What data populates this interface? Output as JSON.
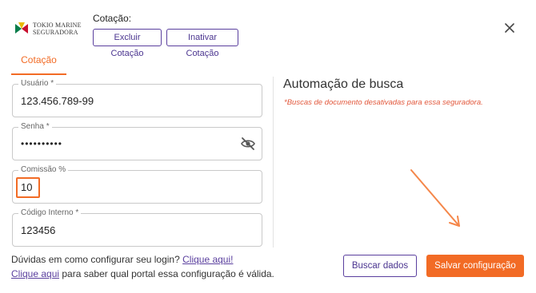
{
  "header": {
    "logo_line1": "TOKIO MARINE",
    "logo_line2": "SEGURADORA",
    "cotacao_label": "Cotação:",
    "excluir_label": "Excluir Cotação",
    "inativar_label": "Inativar Cotação",
    "close_icon": "close-icon"
  },
  "tabs": [
    {
      "label": "Cotação",
      "active": true
    }
  ],
  "form": {
    "usuario": {
      "label": "Usuário *",
      "value": "123.456.789-99"
    },
    "senha": {
      "label": "Senha *",
      "value": "••••••••••",
      "icon": "eye-off-icon"
    },
    "comissao": {
      "label": "Comissão %",
      "value": "10"
    },
    "codigo": {
      "label": "Código Interno *",
      "value": "123456"
    }
  },
  "automation": {
    "title": "Automação de busca",
    "note": "*Buscas de documento desativadas para essa seguradora."
  },
  "help": {
    "line1_text": "Dúvidas em como configurar seu login? ",
    "line1_link": "Clique aqui!",
    "line2_link": "Clique aqui",
    "line2_text": " para saber qual portal essa configuração é válida."
  },
  "actions": {
    "buscar_label": "Buscar dados",
    "salvar_label": "Salvar configuração"
  },
  "colors": {
    "accent": "#f26b25",
    "brand_purple": "#5a3f9e",
    "note_red": "#e2583c"
  }
}
